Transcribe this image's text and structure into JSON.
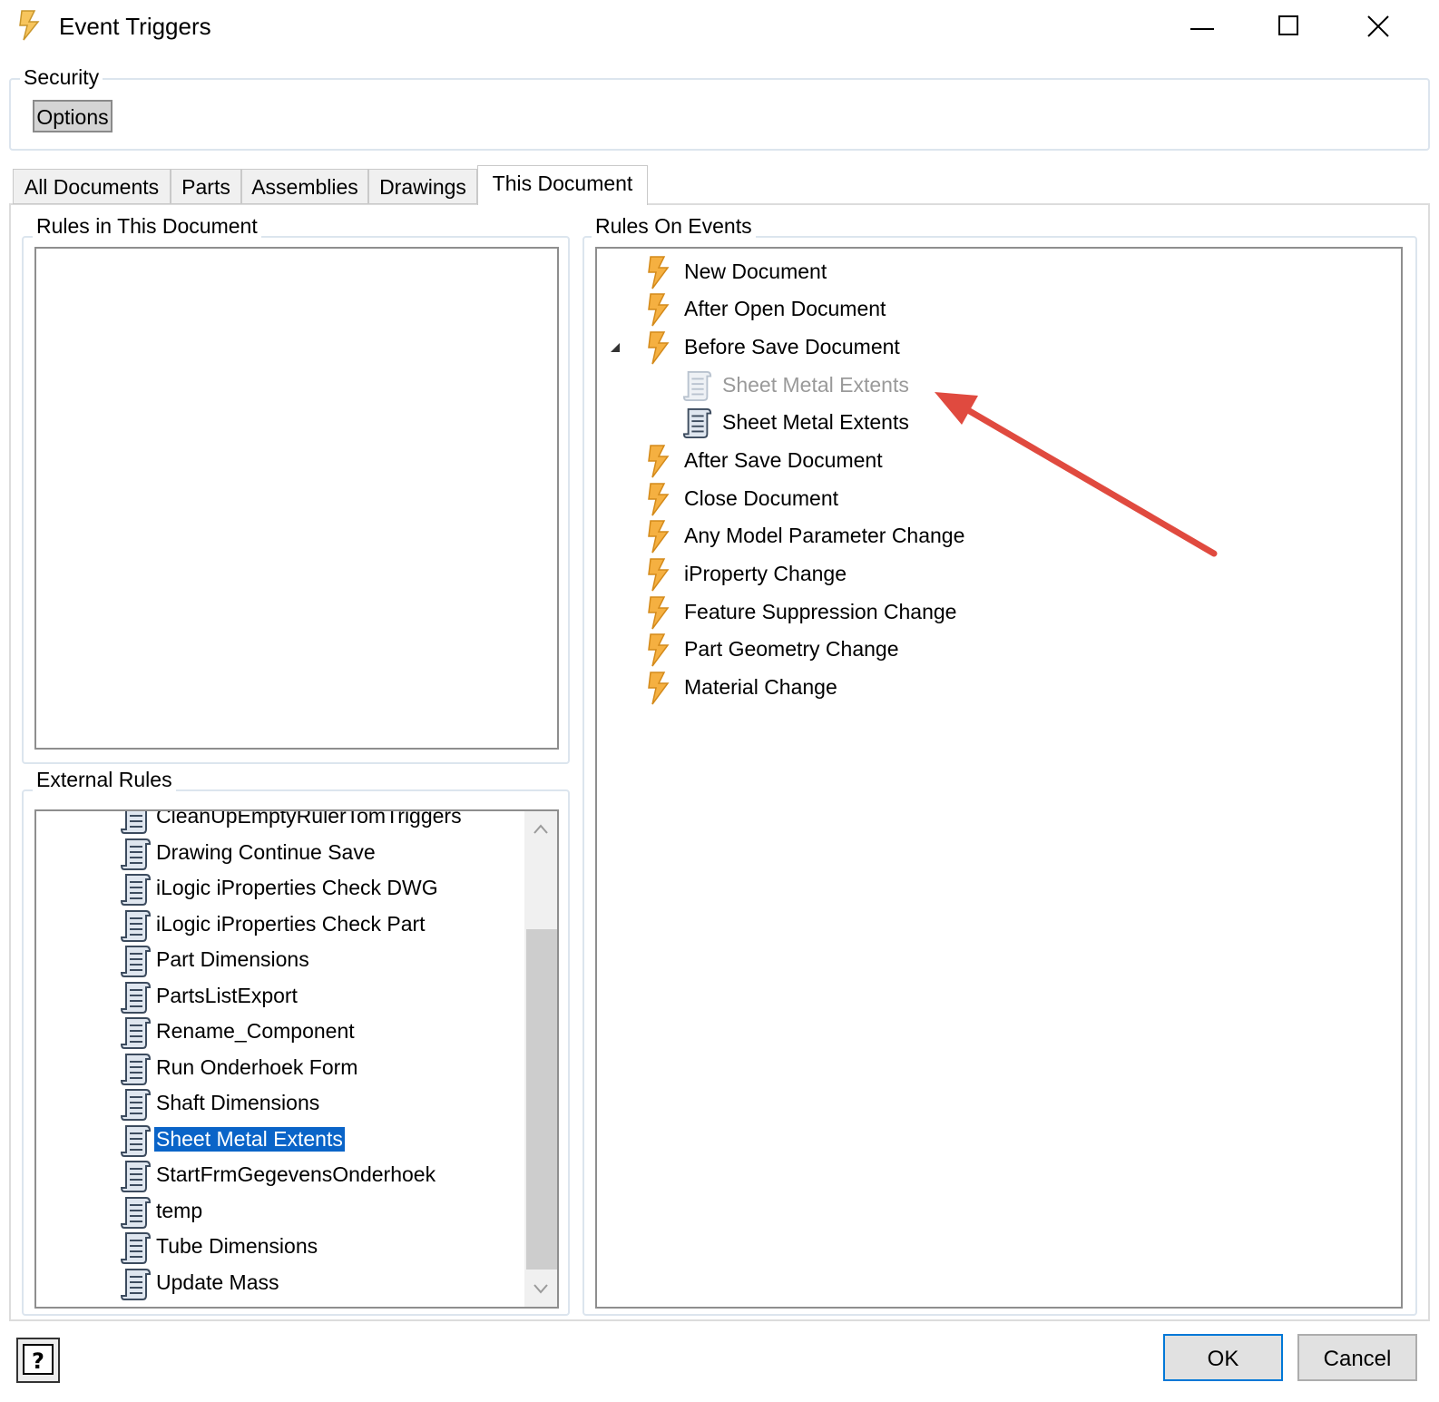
{
  "window": {
    "title": "Event Triggers"
  },
  "security": {
    "label": "Security",
    "options_label": "Options"
  },
  "tabs": [
    {
      "label": "All Documents"
    },
    {
      "label": "Parts"
    },
    {
      "label": "Assemblies"
    },
    {
      "label": "Drawings"
    },
    {
      "label": "This Document",
      "active": true
    }
  ],
  "rules_in_doc": {
    "label": "Rules in This Document"
  },
  "external_rules": {
    "label": "External Rules",
    "items": [
      {
        "label": "CleanUpEmptyRulerTomTriggers",
        "partial": true
      },
      {
        "label": "Drawing Continue Save"
      },
      {
        "label": "iLogic iProperties Check DWG"
      },
      {
        "label": "iLogic iProperties Check Part"
      },
      {
        "label": "Part Dimensions"
      },
      {
        "label": "PartsListExport"
      },
      {
        "label": "Rename_Component"
      },
      {
        "label": "Run Onderhoek Form"
      },
      {
        "label": "Shaft Dimensions"
      },
      {
        "label": "Sheet Metal Extents",
        "selected": true
      },
      {
        "label": "StartFrmGegevensOnderhoek"
      },
      {
        "label": "temp"
      },
      {
        "label": "Tube Dimensions"
      },
      {
        "label": "Update Mass"
      }
    ]
  },
  "rules_on_events": {
    "label": "Rules On Events",
    "events": [
      {
        "label": "New Document"
      },
      {
        "label": "After Open Document"
      },
      {
        "label": "Before Save Document",
        "expanded": true
      },
      {
        "label": "Sheet Metal Extents",
        "child": true,
        "disabled": true
      },
      {
        "label": "Sheet Metal Extents",
        "child": true
      },
      {
        "label": "After Save Document"
      },
      {
        "label": "Close Document"
      },
      {
        "label": "Any Model Parameter Change"
      },
      {
        "label": "iProperty Change"
      },
      {
        "label": "Feature Suppression Change"
      },
      {
        "label": "Part Geometry Change"
      },
      {
        "label": "Material Change"
      }
    ]
  },
  "buttons": {
    "help_label": "?",
    "ok_label": "OK",
    "cancel_label": "Cancel"
  },
  "colors": {
    "selection": "#0a64c8",
    "annotation_arrow": "#e04a3f",
    "lightning": "#f5b041"
  },
  "icons": {
    "event": "lightning-icon",
    "rule": "rule-scroll-icon"
  }
}
